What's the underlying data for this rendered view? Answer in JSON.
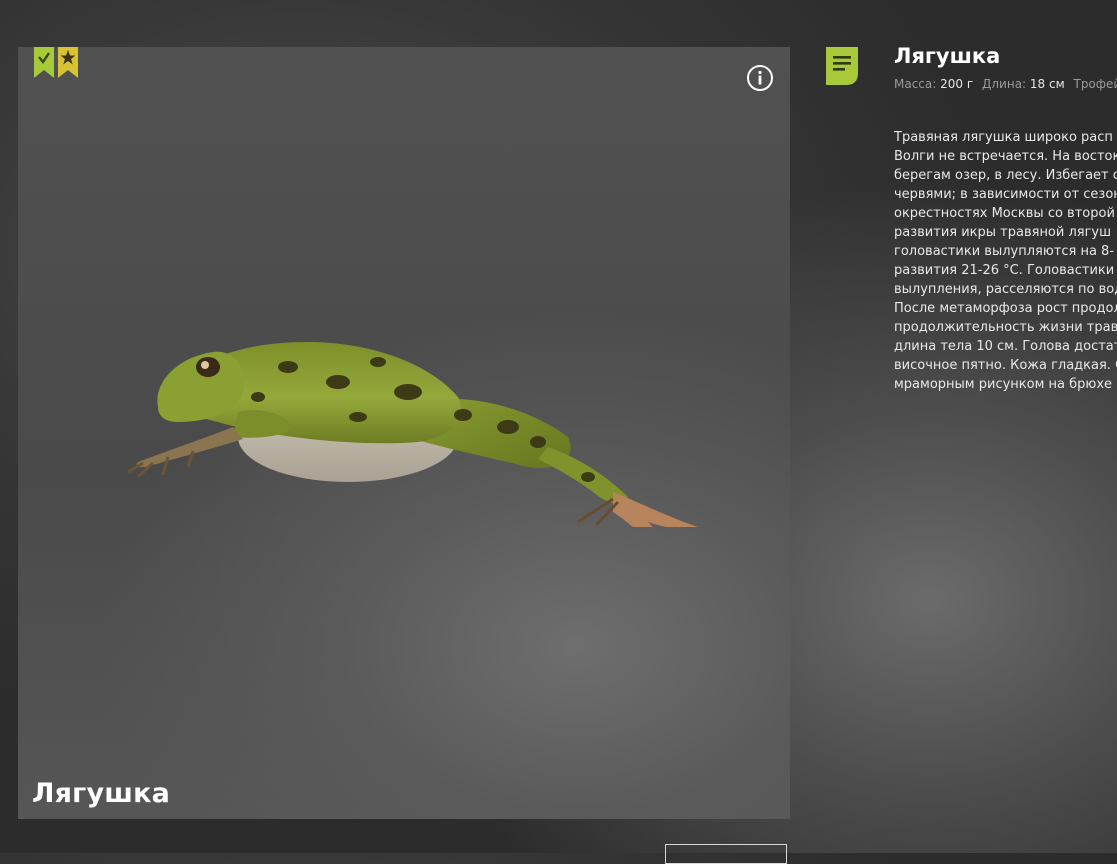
{
  "colors": {
    "accent": "#a7c93a",
    "ribbon_dark": "#7a9a22",
    "text_primary": "#ffffff",
    "text_secondary": "#9a9a9a"
  },
  "badges": [
    "check-ribbon-icon",
    "star-ribbon-icon"
  ],
  "viewer": {
    "title": "Лягушка",
    "info_icon": "info-icon"
  },
  "details": {
    "icon": "document-icon",
    "title": "Лягушка",
    "stats": [
      {
        "label": "Масса:",
        "value": "200 г"
      },
      {
        "label": "Длина:",
        "value": "18 см"
      },
      {
        "label": "Трофейны",
        "value": ""
      }
    ],
    "description_lines": [
      "Травяная лягушка широко расп",
      "Волги не встречается. На восток",
      "берегам озер, в лесу. Избегает с",
      "червями; в зависимости от сезон",
      "окрестностях Москвы со второй",
      "развития икры травяной лягуш",
      "головастики вылупляются на 8-",
      "развития 21-26 °C. Головастики ж",
      "вылупления, расселяются по вод",
      "После метаморфоза рост продол",
      "продолжительность жизни трав",
      "длина тела 10 см. Голова достато",
      "височное пятно. Кожа гладкая. С",
      "мраморным рисунком на брюхе"
    ]
  }
}
